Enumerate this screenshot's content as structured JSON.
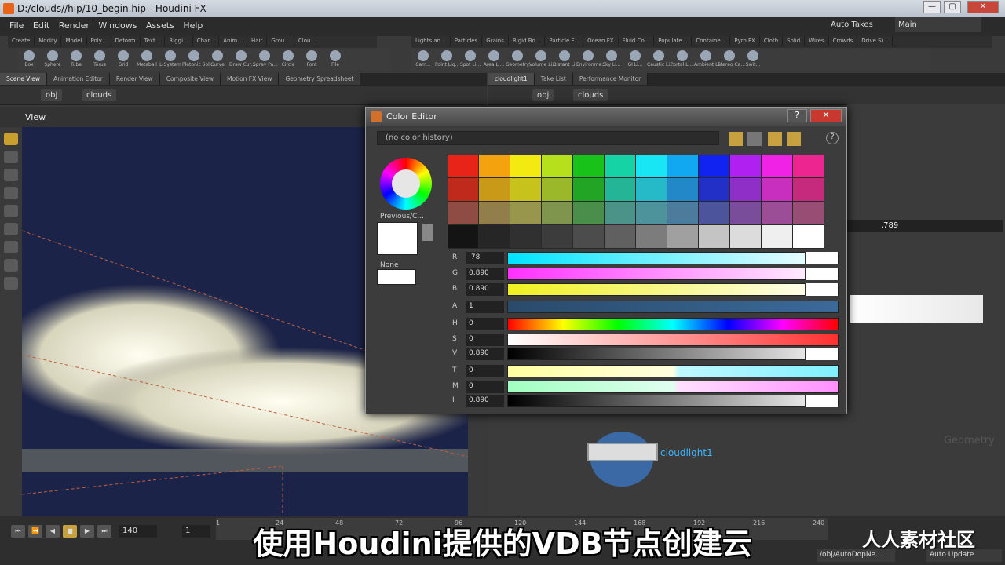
{
  "window": {
    "title": "D:/clouds//hip/10_begin.hip - Houdini FX",
    "minimize": "—",
    "maximize": "▢",
    "close": "✕"
  },
  "menu": [
    "File",
    "Edit",
    "Render",
    "Windows",
    "Assets",
    "Help"
  ],
  "takes": {
    "label": "Auto Takes",
    "main": "Main"
  },
  "shelf_left_tabs": [
    "Create",
    "Modify",
    "Model",
    "Poly...",
    "Deform",
    "Text...",
    "Riggi...",
    "Char...",
    "Anim...",
    "Hair",
    "Grou...",
    "Clou..."
  ],
  "shelf_right_tabs": [
    "Lights an...",
    "Particles",
    "Grains",
    "Rigid Bo...",
    "Particle F...",
    "Ocean FX",
    "Fluid Co...",
    "Populate...",
    "Containe...",
    "Pyro FX",
    "Cloth",
    "Solid",
    "Wires",
    "Crowds",
    "Drive Si..."
  ],
  "tools_left": [
    "Box",
    "Sphere",
    "Tube",
    "Torus",
    "Grid",
    "Metaball",
    "L-System",
    "Platonic Sol...",
    "Curve",
    "Draw Cur...",
    "Spray Pa...",
    "Circle",
    "Font",
    "File"
  ],
  "tools_right": [
    "Cam...",
    "Point Lig...",
    "Spot Li...",
    "Area Li...",
    "Geometry...",
    "Volume Li...",
    "Distant Li...",
    "Environme...",
    "Sky Li...",
    "GI Li...",
    "Caustic Li...",
    "Portal Li...",
    "Ambient Li...",
    "Stereo Ca...",
    "Swit..."
  ],
  "left_pane_tabs": [
    "Scene View",
    "Animation Editor",
    "Render View",
    "Composite View",
    "Motion FX View",
    "Geometry Spreadsheet"
  ],
  "right_pane_tabs": [
    "cloudlight1",
    "Take List",
    "Performance Monitor"
  ],
  "path": {
    "obj": "obj",
    "node": "clouds"
  },
  "viewport": {
    "label": "View"
  },
  "color_editor": {
    "title": "Color Editor",
    "history": "(no color history)",
    "previous_label": "Previous/C...",
    "none_label": "None",
    "swatch_rows": [
      [
        "#e82318",
        "#f5a20f",
        "#f2ea10",
        "#b7e01c",
        "#18c219",
        "#15d3a5",
        "#18e6f5",
        "#11a8f1",
        "#1123f0",
        "#b020f0",
        "#f022e6",
        "#ec2590"
      ],
      [
        "#c02a1c",
        "#c89a18",
        "#c8c21c",
        "#9ab82a",
        "#22a524",
        "#23b595",
        "#26bac8",
        "#2388c8",
        "#2330c8",
        "#8f2fc8",
        "#c82fbf",
        "#c52a7c"
      ],
      [
        "#8f4c45",
        "#917e4b",
        "#98964c",
        "#7f944d",
        "#4b8e4c",
        "#4b9288",
        "#4d939b",
        "#4c7b9b",
        "#4c559b",
        "#7a4d9b",
        "#9b4d96",
        "#984d74"
      ],
      [
        "#141414",
        "#262626",
        "#303030",
        "#3c3c3c",
        "#4c4c4c",
        "#606060",
        "#7c7c7c",
        "#a0a0a0",
        "#c4c4c4",
        "#dcdcdc",
        "#efefef",
        "#ffffff"
      ]
    ],
    "channels": [
      {
        "label": "R",
        "value": ".78"
      },
      {
        "label": "G",
        "value": "0.890"
      },
      {
        "label": "B",
        "value": "0.890"
      },
      {
        "label": "A",
        "value": "1"
      },
      {
        "label": "H",
        "value": "0"
      },
      {
        "label": "S",
        "value": "0"
      },
      {
        "label": "V",
        "value": "0.890"
      },
      {
        "label": "T",
        "value": "0"
      },
      {
        "label": "M",
        "value": "0"
      },
      {
        "label": "I",
        "value": "0.890"
      }
    ]
  },
  "right_panel": {
    "value": ".789"
  },
  "network": {
    "node_label": "cloudlight1",
    "watermark": "Geometry"
  },
  "playbar": {
    "frame": "140",
    "step": "1",
    "ticks": [
      "1",
      "24",
      "48",
      "72",
      "96",
      "120",
      "144",
      "168",
      "192",
      "216",
      "240"
    ]
  },
  "status": {
    "path": "/obj/AutoDopNe...",
    "update": "Auto Update"
  },
  "subtitle": "使用Houdini提供的VDB节点创建云",
  "watermark_brand": "人人素材社区"
}
